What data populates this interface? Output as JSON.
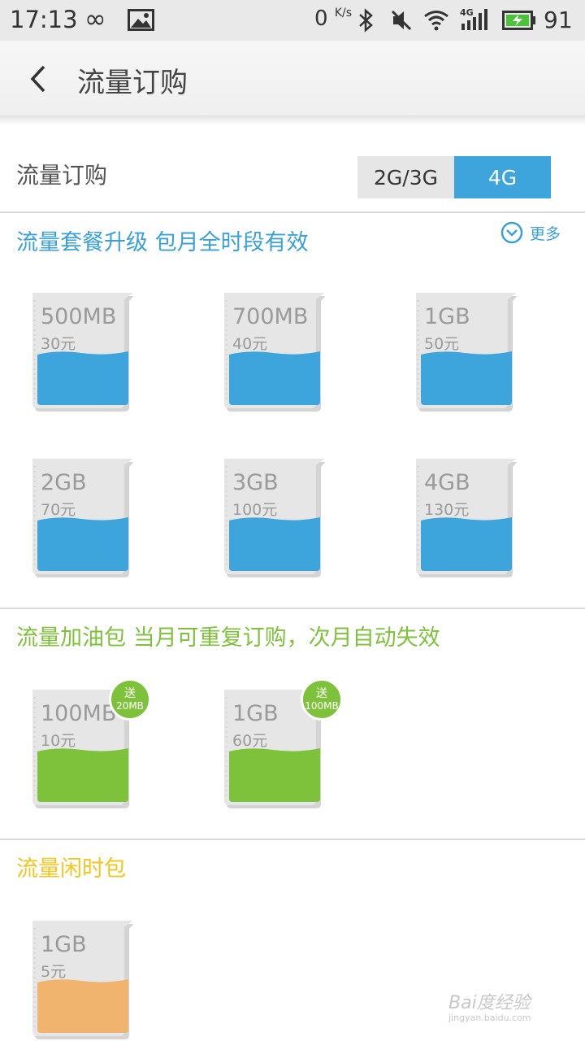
{
  "status_bar": {
    "time": "17:13",
    "infinity_symbol": "∞",
    "net_speed_value": "0",
    "net_speed_unit": "K/s",
    "signal_label": "4G",
    "battery_level": "91",
    "icons": [
      "infinity-icon",
      "image-icon",
      "bluetooth-icon",
      "mute-icon",
      "wifi-icon",
      "signal-4g-icon",
      "battery-charging-icon"
    ]
  },
  "header": {
    "title": "流量订购",
    "back_icon": "chevron-left-icon"
  },
  "network_selector": {
    "label": "流量订购",
    "options": [
      "2G/3G",
      "4G"
    ],
    "selected": "4G"
  },
  "colors": {
    "blue": "#3ea4dc",
    "green": "#7ec13a",
    "yellow": "#f2c520",
    "orange": "#f0b46e"
  },
  "sections": [
    {
      "title": "流量套餐升级 包月全时段有效",
      "more_label": "更多",
      "color": "#3aa1d8",
      "fill_color": "#3ea4dc",
      "cards": [
        {
          "size": "500MB",
          "price": "30元"
        },
        {
          "size": "700MB",
          "price": "40元"
        },
        {
          "size": "1GB",
          "price": "50元"
        },
        {
          "size": "2GB",
          "price": "70元"
        },
        {
          "size": "3GB",
          "price": "100元"
        },
        {
          "size": "4GB",
          "price": "130元"
        }
      ]
    },
    {
      "title": "流量加油包 当月可重复订购，次月自动失效",
      "color": "#7ec13a",
      "fill_color": "#7ec13a",
      "cards": [
        {
          "size": "100MB",
          "price": "10元",
          "badge_label": "送",
          "badge_amount": "20MB"
        },
        {
          "size": "1GB",
          "price": "60元",
          "badge_label": "送",
          "badge_amount": "100MB"
        }
      ]
    },
    {
      "title": "流量闲时包",
      "color": "#f2c520",
      "fill_color": "#f0b46e",
      "cards": [
        {
          "size": "1GB",
          "price": "5元"
        }
      ]
    }
  ],
  "watermark": {
    "text": "Bai度经验",
    "sub": "jingyan.baidu.com"
  }
}
